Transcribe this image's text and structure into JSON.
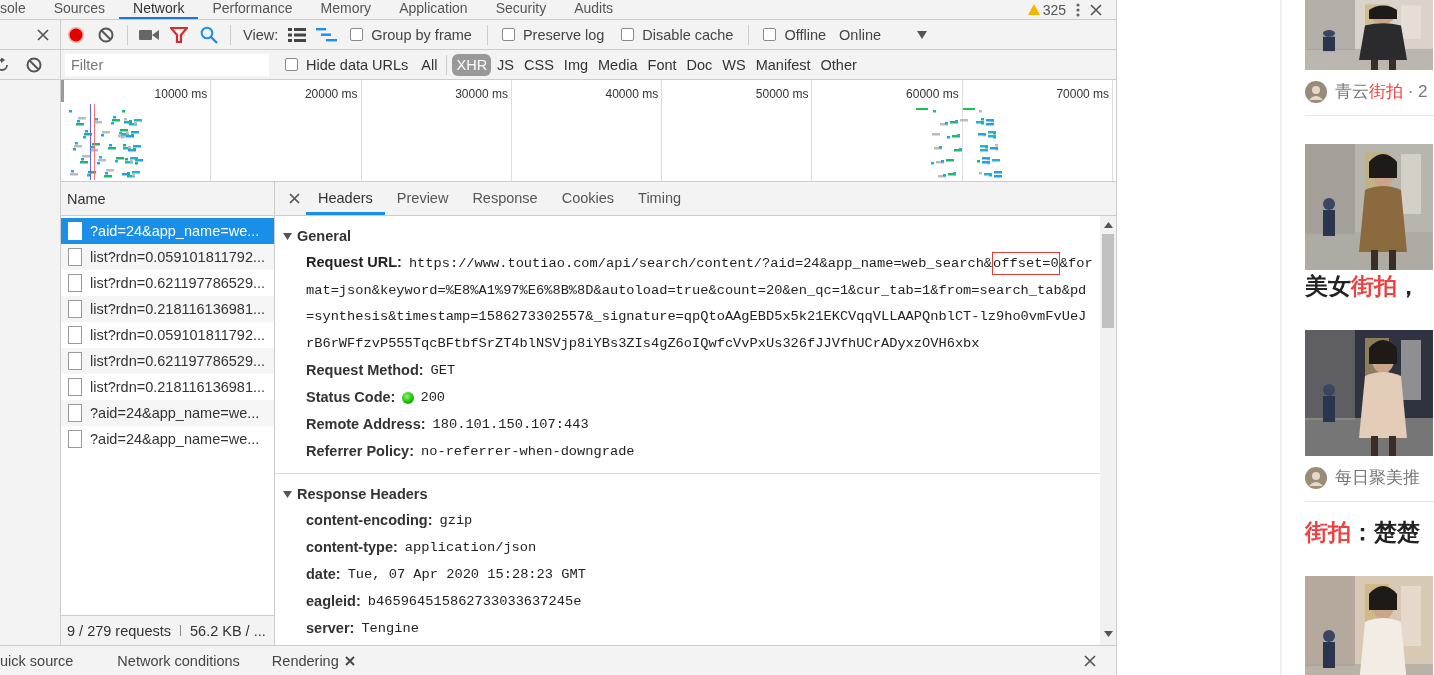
{
  "top_tabs": [
    {
      "label": "sole",
      "selected": false
    },
    {
      "label": "Sources",
      "selected": false
    },
    {
      "label": "Network",
      "selected": true
    },
    {
      "label": "Performance",
      "selected": false
    },
    {
      "label": "Memory",
      "selected": false
    },
    {
      "label": "Application",
      "selected": false
    },
    {
      "label": "Security",
      "selected": false
    },
    {
      "label": "Audits",
      "selected": false
    }
  ],
  "warning_count": "325",
  "toolbar": {
    "recording": true,
    "view_label": "View:",
    "large_rows": false,
    "overview": true,
    "checkboxes": [
      {
        "label": "Group by frame",
        "checked": false
      },
      {
        "label": "Preserve log",
        "checked": false
      },
      {
        "label": "Disable cache",
        "checked": false
      },
      {
        "label": "Offline",
        "checked": false
      }
    ],
    "throttling": "Online"
  },
  "filter": {
    "placeholder": "Filter",
    "hide_data_urls": {
      "label": "Hide data URLs",
      "checked": false
    },
    "types": [
      {
        "label": "All",
        "selected": false
      },
      {
        "label": "XHR",
        "selected": true
      },
      {
        "label": "JS",
        "selected": false
      },
      {
        "label": "CSS",
        "selected": false
      },
      {
        "label": "Img",
        "selected": false
      },
      {
        "label": "Media",
        "selected": false
      },
      {
        "label": "Font",
        "selected": false
      },
      {
        "label": "Doc",
        "selected": false
      },
      {
        "label": "WS",
        "selected": false
      },
      {
        "label": "Manifest",
        "selected": false
      },
      {
        "label": "Other",
        "selected": false
      }
    ]
  },
  "overview": {
    "ticks": [
      "10000 ms",
      "20000 ms",
      "30000 ms",
      "40000 ms",
      "50000 ms",
      "60000 ms",
      "70000 ms"
    ]
  },
  "requests": {
    "header": "Name",
    "rows": [
      {
        "name": "?aid=24&app_name=we...",
        "selected": true
      },
      {
        "name": "list?rdn=0.059101811792...",
        "selected": false
      },
      {
        "name": "list?rdn=0.621197786529...",
        "selected": false
      },
      {
        "name": "list?rdn=0.218116136981...",
        "selected": false
      },
      {
        "name": "list?rdn=0.059101811792...",
        "selected": false
      },
      {
        "name": "list?rdn=0.621197786529...",
        "selected": false
      },
      {
        "name": "list?rdn=0.218116136981...",
        "selected": false
      },
      {
        "name": "?aid=24&app_name=we...",
        "selected": false
      },
      {
        "name": "?aid=24&app_name=we...",
        "selected": false
      }
    ],
    "summary": "9 / 279 requests",
    "transferred": "56.2 KB / ..."
  },
  "details": {
    "tabs": [
      {
        "label": "Headers",
        "selected": true
      },
      {
        "label": "Preview",
        "selected": false
      },
      {
        "label": "Response",
        "selected": false
      },
      {
        "label": "Cookies",
        "selected": false
      },
      {
        "label": "Timing",
        "selected": false
      }
    ],
    "sections": [
      {
        "title": "General",
        "expanded": true,
        "rows": [
          {
            "kind": "url",
            "key": "Request URL:",
            "parts": [
              {
                "text": "https://www.toutiao.com/api/search/content/?aid=24&app_name=web_search&",
                "highlighted": false
              },
              {
                "text": "offset=0",
                "highlighted": true
              },
              {
                "text": "&format=json&keyword=%E8%A1%97%E6%8B%8D&autoload=true&count=20&en_qc=1&cur_tab=1&from=search_tab&pd=synthesis&timestamp=1586273302557&_signature=qpQtoAAgEBD5x5k21EKCVqqVLLAAPQnblCT-lz9ho0vmFvUeJrB6rWFfzvP555TqcBFtbfSrZT4blNSVjp8iYBs3ZIs4gZ6oIQwfcVvPxUs326fJJVfhUCrADyxzOVH6xbx",
                "highlighted": false
              }
            ]
          },
          {
            "kind": "text",
            "key": "Request Method:",
            "value": "GET"
          },
          {
            "kind": "status",
            "key": "Status Code:",
            "value": "200"
          },
          {
            "kind": "text",
            "key": "Remote Address:",
            "value": "180.101.150.107:443"
          },
          {
            "kind": "text",
            "key": "Referrer Policy:",
            "value": "no-referrer-when-downgrade"
          }
        ]
      },
      {
        "title": "Response Headers",
        "expanded": true,
        "rows": [
          {
            "kind": "text",
            "key": "content-encoding:",
            "value": "gzip"
          },
          {
            "kind": "text",
            "key": "content-type:",
            "value": "application/json"
          },
          {
            "kind": "text",
            "key": "date:",
            "value": "Tue, 07 Apr 2020 15:28:23 GMT"
          },
          {
            "kind": "text",
            "key": "eagleid:",
            "value": "b465964515862733033637245e"
          },
          {
            "kind": "text",
            "key": "server:",
            "value": "Tengine"
          }
        ]
      }
    ]
  },
  "drawer_tabs": [
    {
      "label": "uick source",
      "closable": false
    },
    {
      "label": "Network conditions",
      "closable": false
    },
    {
      "label": "Rendering",
      "closable": true
    }
  ],
  "feed": [
    {
      "kind": "picture"
    },
    {
      "kind": "author",
      "parts": [
        {
          "text": "青云",
          "highlighted": false
        },
        {
          "text": "街拍",
          "highlighted": true
        },
        {
          "text": " · 2",
          "highlighted": false
        }
      ]
    },
    {
      "kind": "picture"
    },
    {
      "kind": "title",
      "parts": [
        {
          "text": "美女",
          "highlighted": false
        },
        {
          "text": "街拍",
          "highlighted": true
        },
        {
          "text": "，",
          "highlighted": false
        }
      ]
    },
    {
      "kind": "picture"
    },
    {
      "kind": "author",
      "parts": [
        {
          "text": "每日聚美推",
          "highlighted": false
        }
      ]
    },
    {
      "kind": "title",
      "parts": [
        {
          "text": "街拍",
          "highlighted": true
        },
        {
          "text": "：楚楚",
          "highlighted": false
        }
      ]
    },
    {
      "kind": "picture"
    }
  ]
}
